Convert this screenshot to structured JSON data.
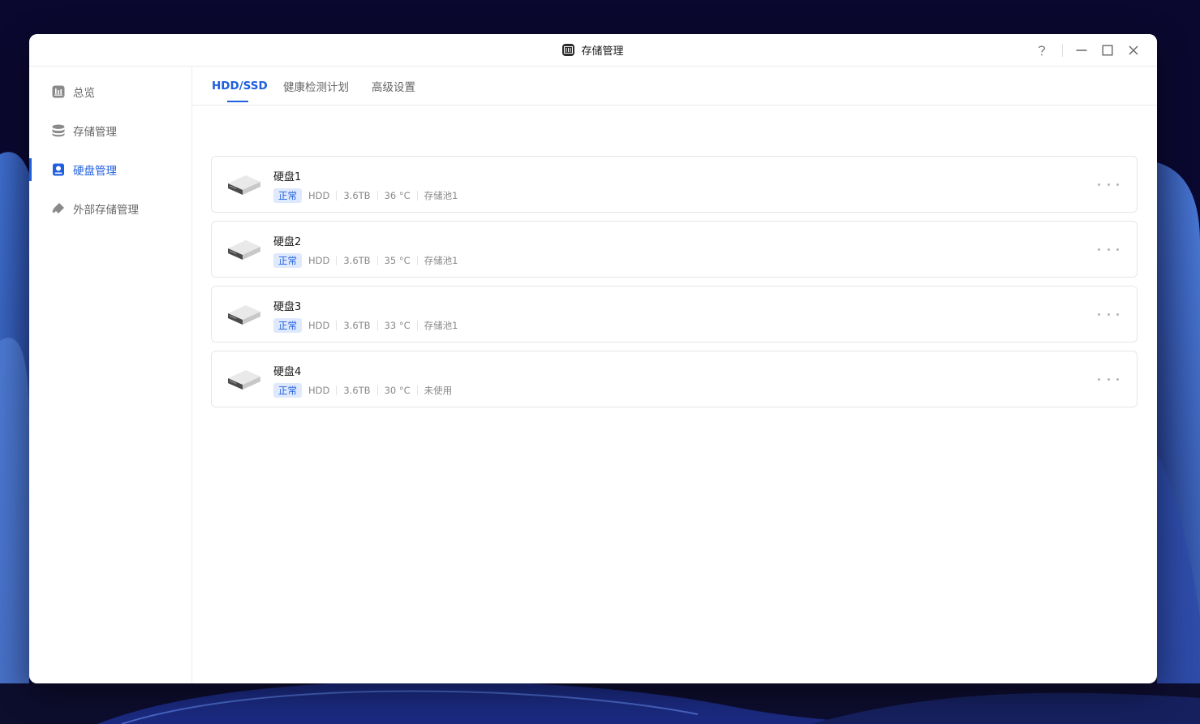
{
  "window": {
    "title": "存储管理"
  },
  "sidebar": {
    "items": [
      {
        "label": "总览",
        "icon": "overview-icon",
        "active": false
      },
      {
        "label": "存储管理",
        "icon": "database-icon",
        "active": false
      },
      {
        "label": "硬盘管理",
        "icon": "hard-disk-icon",
        "active": true
      },
      {
        "label": "外部存储管理",
        "icon": "usb-drive-icon",
        "active": false
      }
    ]
  },
  "tabs": [
    {
      "label": "HDD/SSD",
      "active": true
    },
    {
      "label": "健康检测计划",
      "active": false
    },
    {
      "label": "高级设置",
      "active": false
    }
  ],
  "disks": [
    {
      "name": "硬盘1",
      "status": "正常",
      "type": "HDD",
      "capacity": "3.6TB",
      "temperature": "36 °C",
      "pool": "存储池1"
    },
    {
      "name": "硬盘2",
      "status": "正常",
      "type": "HDD",
      "capacity": "3.6TB",
      "temperature": "35 °C",
      "pool": "存储池1"
    },
    {
      "name": "硬盘3",
      "status": "正常",
      "type": "HDD",
      "capacity": "3.6TB",
      "temperature": "33 °C",
      "pool": "存储池1"
    },
    {
      "name": "硬盘4",
      "status": "正常",
      "type": "HDD",
      "capacity": "3.6TB",
      "temperature": "30 °C",
      "pool": "未使用"
    }
  ],
  "colors": {
    "accent": "#1f5fe0",
    "badge_bg": "#dfe9fd",
    "desktop_bg": "#0b0830"
  }
}
